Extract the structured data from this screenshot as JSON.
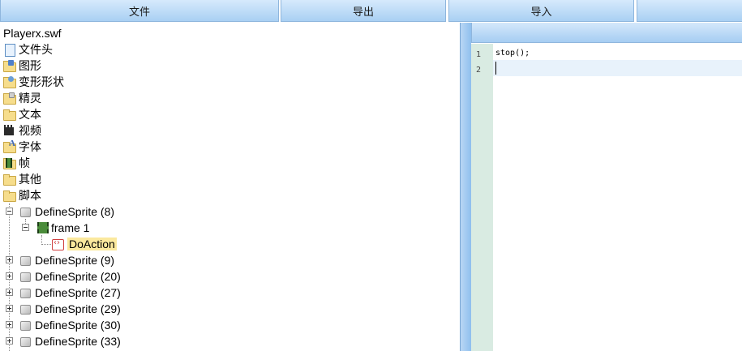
{
  "menu": {
    "file": "文件",
    "export": "导出",
    "import": "导入",
    "extra": ""
  },
  "tree": {
    "root": "Playerx.swf",
    "categories": [
      {
        "label": "文件头",
        "icon": "document-icon"
      },
      {
        "label": "图形",
        "icon": "shapes-folder-icon"
      },
      {
        "label": "变形形状",
        "icon": "morph-shape-folder-icon"
      },
      {
        "label": "精灵",
        "icon": "sprite-folder-icon"
      },
      {
        "label": "文本",
        "icon": "text-folder-icon"
      },
      {
        "label": "视频",
        "icon": "video-clapper-icon"
      },
      {
        "label": "字体",
        "icon": "font-folder-icon"
      },
      {
        "label": "帧",
        "icon": "frame-folder-icon"
      },
      {
        "label": "其他",
        "icon": "folder-icon"
      },
      {
        "label": "脚本",
        "icon": "folder-open-icon"
      }
    ],
    "sprites": [
      {
        "label": "DefineSprite (8)",
        "expanded": true
      },
      {
        "label": "DefineSprite (9)",
        "expanded": false
      },
      {
        "label": "DefineSprite (20)",
        "expanded": false
      },
      {
        "label": "DefineSprite (27)",
        "expanded": false
      },
      {
        "label": "DefineSprite (29)",
        "expanded": false
      },
      {
        "label": "DefineSprite (30)",
        "expanded": false
      },
      {
        "label": "DefineSprite (33)",
        "expanded": false
      }
    ],
    "frame": {
      "label": "frame 1"
    },
    "action": {
      "label": "DoAction",
      "selected": true
    }
  },
  "editor": {
    "lines": [
      {
        "number": "1",
        "code": "stop();"
      },
      {
        "number": "2",
        "code": ""
      }
    ],
    "active_line": "2"
  },
  "colors": {
    "menu_bar": "#a9d0f3",
    "gutter": "#d9ebe2",
    "selection": "#fbe99e"
  }
}
